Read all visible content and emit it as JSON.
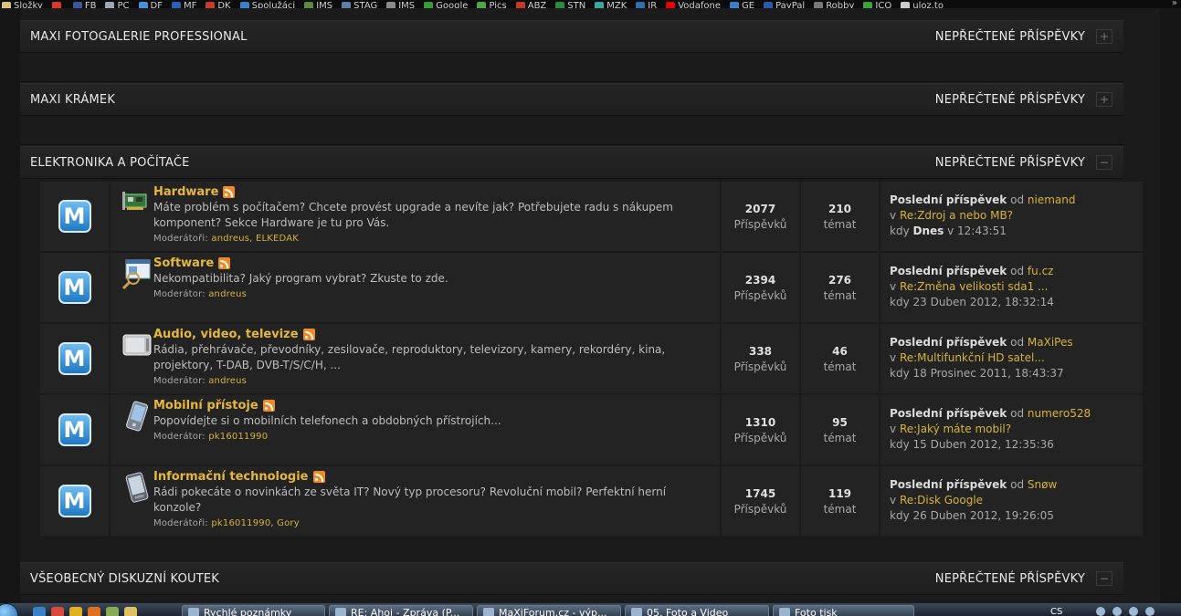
{
  "bookmarks": [
    {
      "label": "Složky",
      "icon": "folder-icon",
      "color": "#d9c27a"
    },
    {
      "label": "",
      "icon": "swoosh-icon",
      "color": "#d93a2a"
    },
    {
      "label": "FB",
      "icon": "facebook-icon",
      "color": "#3b5998"
    },
    {
      "label": "PC",
      "icon": "pc-icon",
      "color": "#9aa7b4"
    },
    {
      "label": "DF",
      "icon": "df-icon",
      "color": "#4a8fd9"
    },
    {
      "label": "MF",
      "icon": "mf-icon",
      "color": "#2a5fb8"
    },
    {
      "label": "DK",
      "icon": "dk-icon",
      "color": "#c8382c"
    },
    {
      "label": "Spolužáci",
      "icon": "spoluzaci-icon",
      "color": "#3a7fd0"
    },
    {
      "label": "IMS",
      "icon": "ims-icon",
      "color": "#5a8a3a"
    },
    {
      "label": "STAG",
      "icon": "stag-icon",
      "color": "#5a7fa8"
    },
    {
      "label": "IMS",
      "icon": "ims2-icon",
      "color": "#8a8a8a"
    },
    {
      "label": "Google",
      "icon": "google-icon",
      "color": "#3a9a3a"
    },
    {
      "label": "Pics",
      "icon": "pics-icon",
      "color": "#4aa84a"
    },
    {
      "label": "ABZ",
      "icon": "abz-icon",
      "color": "#c0392b"
    },
    {
      "label": "STN",
      "icon": "stn-icon",
      "color": "#2c8a3a"
    },
    {
      "label": "MZK",
      "icon": "mzk-icon",
      "color": "#3aa6a0"
    },
    {
      "label": "JR",
      "icon": "jr-icon",
      "color": "#2f6fb0"
    },
    {
      "label": "Vodafone",
      "icon": "vodafone-icon",
      "color": "#e60000"
    },
    {
      "label": "GE",
      "icon": "ge-icon",
      "color": "#3b7fc4"
    },
    {
      "label": "PayPal",
      "icon": "paypal-icon",
      "color": "#2b5aa8"
    },
    {
      "label": "Robby",
      "icon": "robby-icon",
      "color": "#777777"
    },
    {
      "label": "ICQ",
      "icon": "icq-icon",
      "color": "#3aa63a"
    },
    {
      "label": "uloz.to",
      "icon": "ulozto-icon",
      "color": "#cccccc"
    }
  ],
  "bookmarks_more": "»",
  "categories": [
    {
      "title": "MAXI FOTOGALERIE PROFESSIONAL",
      "unread": "NEPŘEČTENÉ PŘÍSPĚVKY",
      "toggle": "+"
    },
    {
      "title": "MAXI KRÁMEK",
      "unread": "NEPŘEČTENÉ PŘÍSPĚVKY",
      "toggle": "+"
    },
    {
      "title": "ELEKTRONIKA A POČÍTAČE",
      "unread": "NEPŘEČTENÉ PŘÍSPĚVKY",
      "toggle": "−"
    },
    {
      "title": "VŠEOBECNÝ DISKUZNÍ KOUTEK",
      "unread": "NEPŘEČTENÉ PŘÍSPĚVKY",
      "toggle": "−"
    }
  ],
  "forums": [
    {
      "icon": "hardware-card-icon",
      "title": "Hardware",
      "desc": "Máte problém s počítačem? Chcete provést upgrade a nevíte jak? Potřebujete radu s nákupem komponent? Sekce Hardware je tu pro Vás.",
      "mod_label": "Moderátoři:",
      "mods": "andreus, ELKEDAK",
      "posts": "2077",
      "posts_label": "Příspěvků",
      "topics": "210",
      "topics_label": "témat",
      "last_title": "Poslední příspěvek",
      "last_by": "od",
      "last_user": "niemand",
      "last_in": "v",
      "last_topic": "Re:Zdroj a nebo MB?",
      "last_when_label": "kdy",
      "last_when_bold": "Dnes",
      "last_when": "v 12:43:51"
    },
    {
      "icon": "software-window-icon",
      "title": "Software",
      "desc": "Nekompatibilita? Jaký program vybrat? Zkuste to zde.",
      "mod_label": "Moderátor:",
      "mods": "andreus",
      "posts": "2394",
      "posts_label": "Příspěvků",
      "topics": "276",
      "topics_label": "témat",
      "last_title": "Poslední příspěvek",
      "last_by": "od",
      "last_user": "fu.cz",
      "last_in": "v",
      "last_topic": "Re:Změna velikosti sda1 ...",
      "last_when_label": "kdy",
      "last_when_bold": "",
      "last_when": "23 Duben 2012, 18:32:14"
    },
    {
      "icon": "tv-icon",
      "title": "Audio, video, televize",
      "desc": "Rádia, přehrávače, převodníky, zesilovače, reproduktory, televizory, kamery, rekordéry, kina, projektory, T-DAB, DVB-T/S/C/H, ...",
      "mod_label": "Moderátor:",
      "mods": "andreus",
      "posts": "338",
      "posts_label": "Příspěvků",
      "topics": "46",
      "topics_label": "témat",
      "last_title": "Poslední příspěvek",
      "last_by": "od",
      "last_user": "MaXiPes",
      "last_in": "v",
      "last_topic": "Re:Multifunkční HD satel...",
      "last_when_label": "kdy",
      "last_when_bold": "",
      "last_when": "18 Prosinec 2011, 18:43:37"
    },
    {
      "icon": "pda-icon",
      "title": "Mobilní přístoje",
      "desc": "Popovídejte si o mobilních telefonech a obdobných přístrojích...",
      "mod_label": "Moderátor:",
      "mods": "pk16011990",
      "posts": "1310",
      "posts_label": "Příspěvků",
      "topics": "95",
      "topics_label": "témat",
      "last_title": "Poslední příspěvek",
      "last_by": "od",
      "last_user": "numero528",
      "last_in": "v",
      "last_topic": "Re:Jaký máte mobil?",
      "last_when_label": "kdy",
      "last_when_bold": "",
      "last_when": "15 Duben 2012, 12:35:36"
    },
    {
      "icon": "smartphone-icon",
      "title": "Informační technologie",
      "desc": "Rádi pokecáte o novinkách ze světa IT? Nový typ procesoru? Revoluční mobil? Perfektní herní konzole?",
      "mod_label": "Moderátoři:",
      "mods": "pk16011990, Gory",
      "posts": "1745",
      "posts_label": "Příspěvků",
      "topics": "119",
      "topics_label": "témat",
      "last_title": "Poslední příspěvek",
      "last_by": "od",
      "last_user": "Snøw",
      "last_in": "v",
      "last_topic": "Re:Disk Google",
      "last_when_label": "kdy",
      "last_when_bold": "",
      "last_when": "26 Duben 2012, 19:26:05"
    }
  ],
  "taskbar": {
    "tasks": [
      "Rychlé poznámky",
      "RE: Ahoj - Zpráva (P...",
      "MaXiForum.cz - výp...",
      "05. Foto a Video",
      "Foto tisk"
    ],
    "lang": "CS"
  },
  "colors": {
    "accent": "#e5b83b",
    "link": "#d6b23a",
    "row_bg": "#232323",
    "page_bg": "#1b1b1b"
  }
}
